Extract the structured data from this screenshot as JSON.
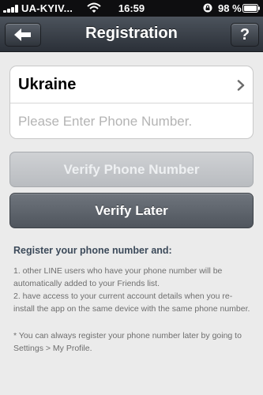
{
  "status_bar": {
    "carrier": "UA-KYIV...",
    "time": "16:59",
    "battery": "98 %",
    "icons": [
      "signal-icon",
      "wifi-icon",
      "orientation-lock-icon",
      "battery-icon"
    ]
  },
  "nav": {
    "title": "Registration",
    "back_icon": "back-arrow-icon",
    "help_label": "?"
  },
  "form": {
    "country": "Ukraine",
    "phone_placeholder": "Please Enter Phone Number.",
    "phone_value": ""
  },
  "buttons": {
    "verify": "Verify Phone Number",
    "later": "Verify Later"
  },
  "info": {
    "heading": "Register your phone number and:",
    "item1": "1. other LINE users who have your phone number will be automatically added to your Friends list.",
    "item2": "2. have access to your current account details when you re-install the app on the same device with the same phone number.",
    "note": "* You can always register your phone number later by going to Settings > My Profile."
  },
  "colors": {
    "nav_bar": "#3a4048",
    "background": "#ebebeb",
    "disabled_button": "#c4c7ca",
    "primary_button": "#5f656d",
    "heading_text": "#3c4a5a"
  }
}
